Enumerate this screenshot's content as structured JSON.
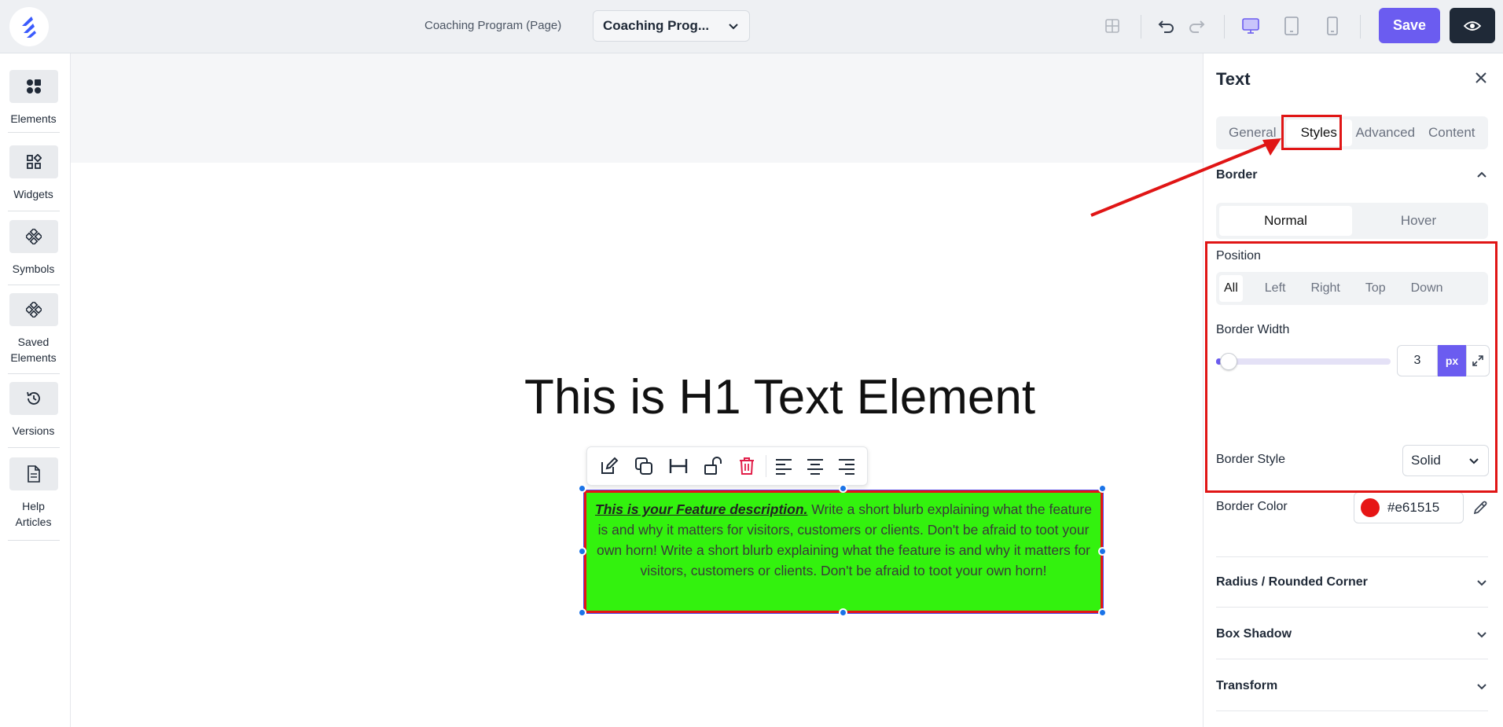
{
  "topbar": {
    "page_name": "Coaching Program (Page)",
    "page_select_value": "Coaching Prog...",
    "save_label": "Save"
  },
  "left_sidebar": {
    "items": [
      {
        "label": "Elements",
        "icon": "elements-icon"
      },
      {
        "label": "Widgets",
        "icon": "widgets-icon"
      },
      {
        "label": "Symbols",
        "icon": "symbols-icon"
      },
      {
        "label": "Saved Elements",
        "icon": "saved-elements-icon"
      },
      {
        "label": "Versions",
        "icon": "history-icon"
      },
      {
        "label": "Help Articles",
        "icon": "document-icon"
      }
    ]
  },
  "canvas": {
    "h1": "This is H1 Text Element",
    "feature_strong": "This is your Feature description.",
    "feature_body": " Write a short blurb explaining what the feature is and why it matters for visitors, customers or clients. Don't be afraid to toot your own horn! Write a short blurb explaining what the feature is and why it matters for visitors, customers or clients. Don't be afraid to toot your own horn!",
    "feature_bg": "#33f20e"
  },
  "panel": {
    "title": "Text",
    "tabs": [
      "General",
      "Styles",
      "Advanced",
      "Content"
    ],
    "active_tab": "Styles",
    "border_section": "Border",
    "state_tabs": [
      "Normal",
      "Hover"
    ],
    "position_label": "Position",
    "positions": [
      "All",
      "Left",
      "Right",
      "Top",
      "Down"
    ],
    "border_width_label": "Border Width",
    "border_width_value": "3",
    "border_width_fraction": 0.03,
    "border_width_unit": "px",
    "border_style_label": "Border Style",
    "border_style_value": "Solid",
    "border_color_label": "Border Color",
    "border_color_value": "#e61515",
    "sections": [
      "Radius / Rounded Corner",
      "Box Shadow",
      "Transform"
    ]
  },
  "colors": {
    "accent": "#6b5cf0",
    "annotation": "#e01515"
  }
}
